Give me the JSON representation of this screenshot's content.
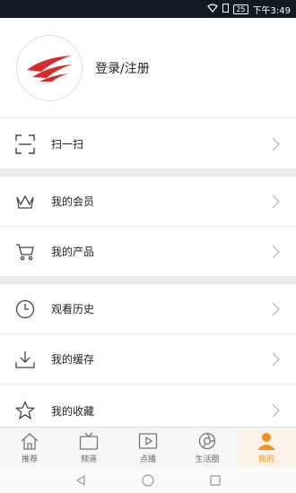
{
  "status": {
    "time": "下午3:49",
    "battery": "25"
  },
  "profile": {
    "login_label": "登录/注册"
  },
  "menu": {
    "scan": "扫一扫",
    "membership": "我的会员",
    "products": "我的产品",
    "history": "观看历史",
    "cache": "我的缓存",
    "favorites": "我的收藏"
  },
  "tabs": {
    "recommend": "推荐",
    "channels": "频道",
    "vod": "点播",
    "circle": "生活圈",
    "mine": "我的"
  },
  "colors": {
    "accent": "#f0921c",
    "logo_red": "#d62b2b",
    "status_bar": "#111a22"
  }
}
